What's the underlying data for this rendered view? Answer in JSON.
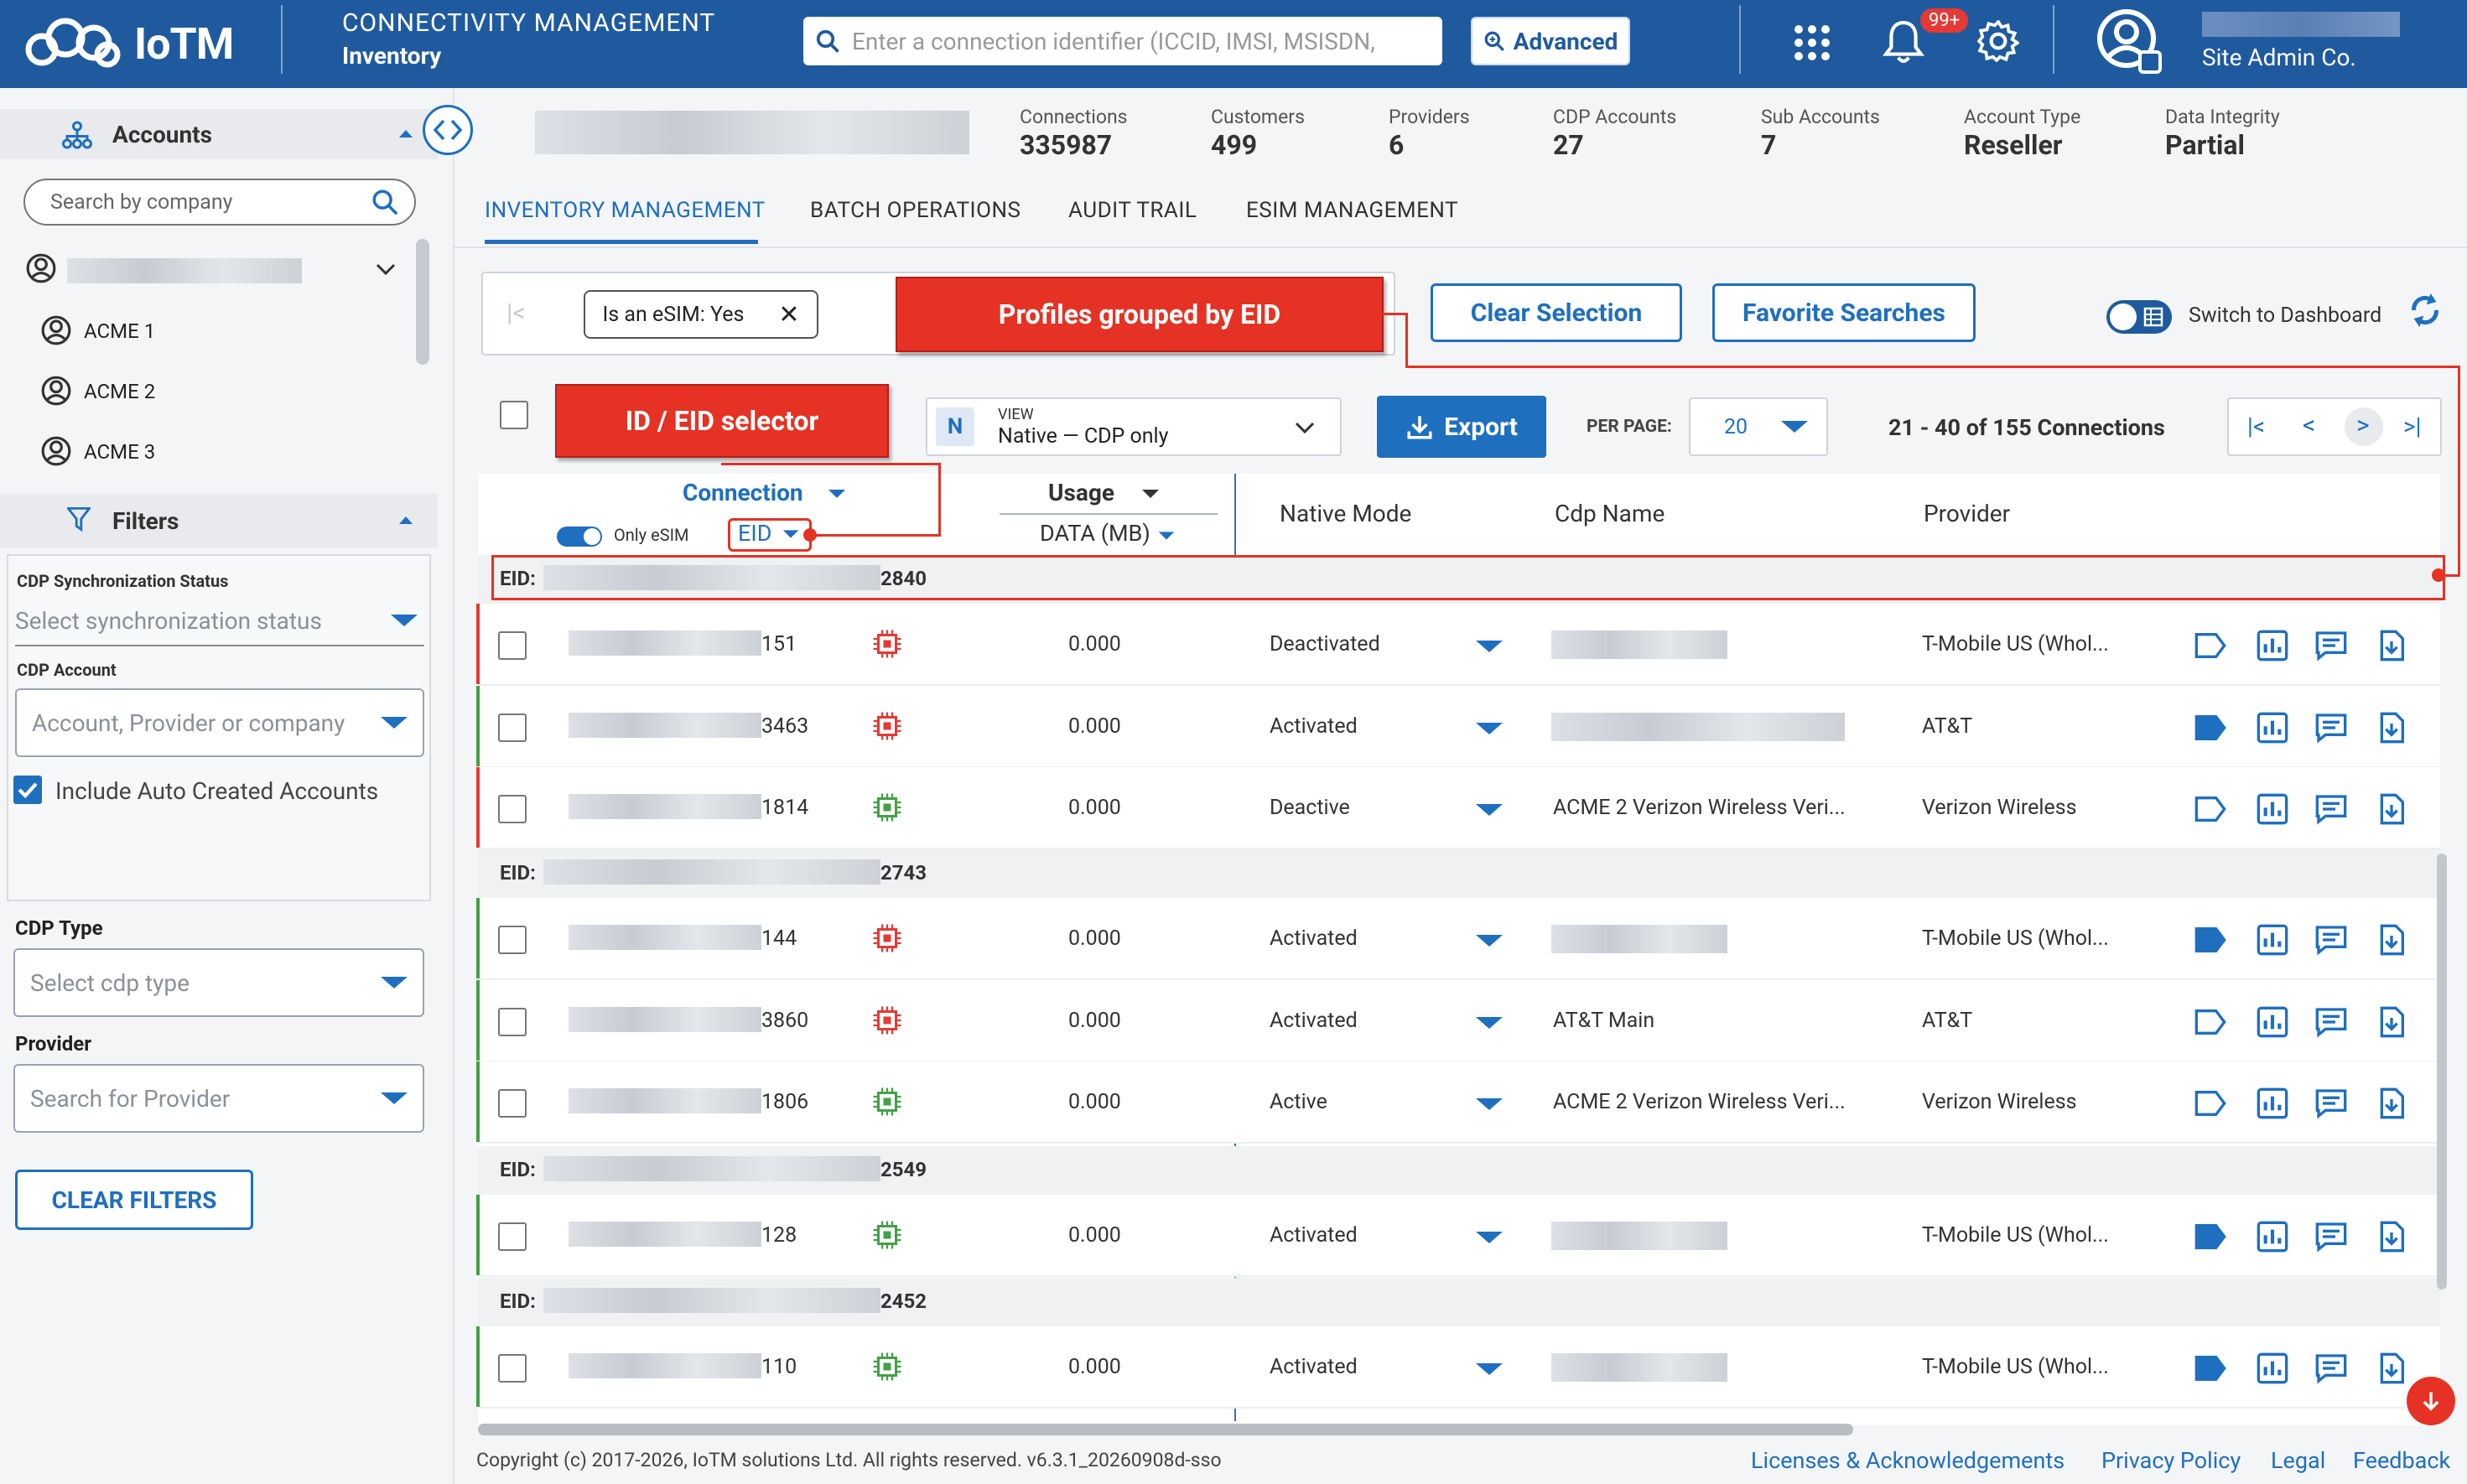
{
  "header": {
    "logo_text": "IoTM",
    "module_title": "CONNECTIVITY MANAGEMENT",
    "module_sub": "Inventory",
    "search_placeholder": "Enter a connection identifier (ICCID, IMSI, MSISDN,",
    "advanced_label": "Advanced",
    "notification_badge": "99+",
    "user_company": "Site Admin Co."
  },
  "sidebar": {
    "accounts_title": "Accounts",
    "company_search_placeholder": "Search by company",
    "accounts": [
      "ACME 1",
      "ACME 2",
      "ACME 3"
    ],
    "filters_title": "Filters",
    "cdp_sync_label": "CDP Synchronization Status",
    "cdp_sync_placeholder": "Select synchronization status",
    "cdp_account_label": "CDP Account",
    "cdp_account_placeholder": "Account, Provider or company",
    "include_auto_label": "Include Auto Created Accounts",
    "cdp_type_label": "CDP Type",
    "cdp_type_placeholder": "Select cdp type",
    "provider_label": "Provider",
    "provider_placeholder": "Search for Provider",
    "clear_filters_label": "CLEAR FILTERS"
  },
  "stats": [
    {
      "label": "Connections",
      "value": "335987"
    },
    {
      "label": "Customers",
      "value": "499"
    },
    {
      "label": "Providers",
      "value": "6"
    },
    {
      "label": "CDP Accounts",
      "value": "27"
    },
    {
      "label": "Sub Accounts",
      "value": "7"
    },
    {
      "label": "Account Type",
      "value": "Reseller"
    },
    {
      "label": "Data Integrity",
      "value": "Partial"
    }
  ],
  "tabs": [
    "INVENTORY MANAGEMENT",
    "BATCH OPERATIONS",
    "AUDIT TRAIL",
    "ESIM MANAGEMENT"
  ],
  "toolbar": {
    "filter_chip": "Is an eSIM: Yes",
    "clear_selection": "Clear Selection",
    "favorite_searches": "Favorite Searches",
    "switch_dashboard": "Switch to Dashboard",
    "view_badge": "N",
    "view_label": "VIEW",
    "view_value": "Native — CDP only",
    "export_label": "Export",
    "per_page_label": "PER PAGE:",
    "per_page_value": "20",
    "pagination_text": "21 - 40 of 155 Connections"
  },
  "callouts": {
    "profiles_grouped": "Profiles grouped by EID",
    "id_eid_selector": "ID / EID selector"
  },
  "columns": {
    "connection": "Connection",
    "only_esim": "Only eSIM",
    "eid_selector": "EID",
    "usage": "Usage",
    "usage_unit": "DATA (MB)",
    "native_mode": "Native Mode",
    "cdp_name": "Cdp Name",
    "provider": "Provider"
  },
  "groups": [
    {
      "eid_prefix": "EID:",
      "eid_suffix": "2840",
      "rows": [
        {
          "id_suffix": "151",
          "chip": "red",
          "usage": "0.000",
          "mode": "Deactivated",
          "cdp": "",
          "provider": "T-Mobile US (Whol...",
          "tag_filled": false,
          "border": "red"
        },
        {
          "id_suffix": "3463",
          "chip": "red",
          "usage": "0.000",
          "mode": "Activated",
          "cdp": "",
          "provider": "AT&T",
          "tag_filled": true,
          "border": "green"
        },
        {
          "id_suffix": "1814",
          "chip": "green",
          "usage": "0.000",
          "mode": "Deactive",
          "cdp": "ACME 2 Verizon Wireless Veri...",
          "provider": "Verizon Wireless",
          "tag_filled": false,
          "border": "red"
        }
      ]
    },
    {
      "eid_prefix": "EID:",
      "eid_suffix": "2743",
      "rows": [
        {
          "id_suffix": "144",
          "chip": "red",
          "usage": "0.000",
          "mode": "Activated",
          "cdp": "",
          "provider": "T-Mobile US (Whol...",
          "tag_filled": true,
          "border": "green"
        },
        {
          "id_suffix": "3860",
          "chip": "red",
          "usage": "0.000",
          "mode": "Activated",
          "cdp": "AT&T Main",
          "provider": "AT&T",
          "tag_filled": false,
          "border": "green"
        },
        {
          "id_suffix": "1806",
          "chip": "green",
          "usage": "0.000",
          "mode": "Active",
          "cdp": "ACME 2 Verizon Wireless Veri...",
          "provider": "Verizon Wireless",
          "tag_filled": false,
          "border": "green"
        }
      ]
    },
    {
      "eid_prefix": "EID:",
      "eid_suffix": "2549",
      "rows": [
        {
          "id_suffix": "128",
          "chip": "green",
          "usage": "0.000",
          "mode": "Activated",
          "cdp": "",
          "provider": "T-Mobile US (Whol...",
          "tag_filled": true,
          "border": "green"
        }
      ]
    },
    {
      "eid_prefix": "EID:",
      "eid_suffix": "2452",
      "rows": [
        {
          "id_suffix": "110",
          "chip": "green",
          "usage": "0.000",
          "mode": "Activated",
          "cdp": "",
          "provider": "T-Mobile US (Whol...",
          "tag_filled": true,
          "border": "green"
        }
      ]
    }
  ],
  "footer": {
    "copyright": "Copyright (c) 2017-2026, IoTM solutions Ltd. All rights reserved. v6.3.1_20260908d-sso",
    "links": [
      "Licenses & Acknowledgements",
      "Privacy Policy",
      "Legal",
      "Feedback"
    ]
  },
  "colors": {
    "brand": "#1f5a9e",
    "accent": "#1f6fbf",
    "callout": "#e53224",
    "chip_red": "#e53935",
    "chip_green": "#43a047"
  }
}
